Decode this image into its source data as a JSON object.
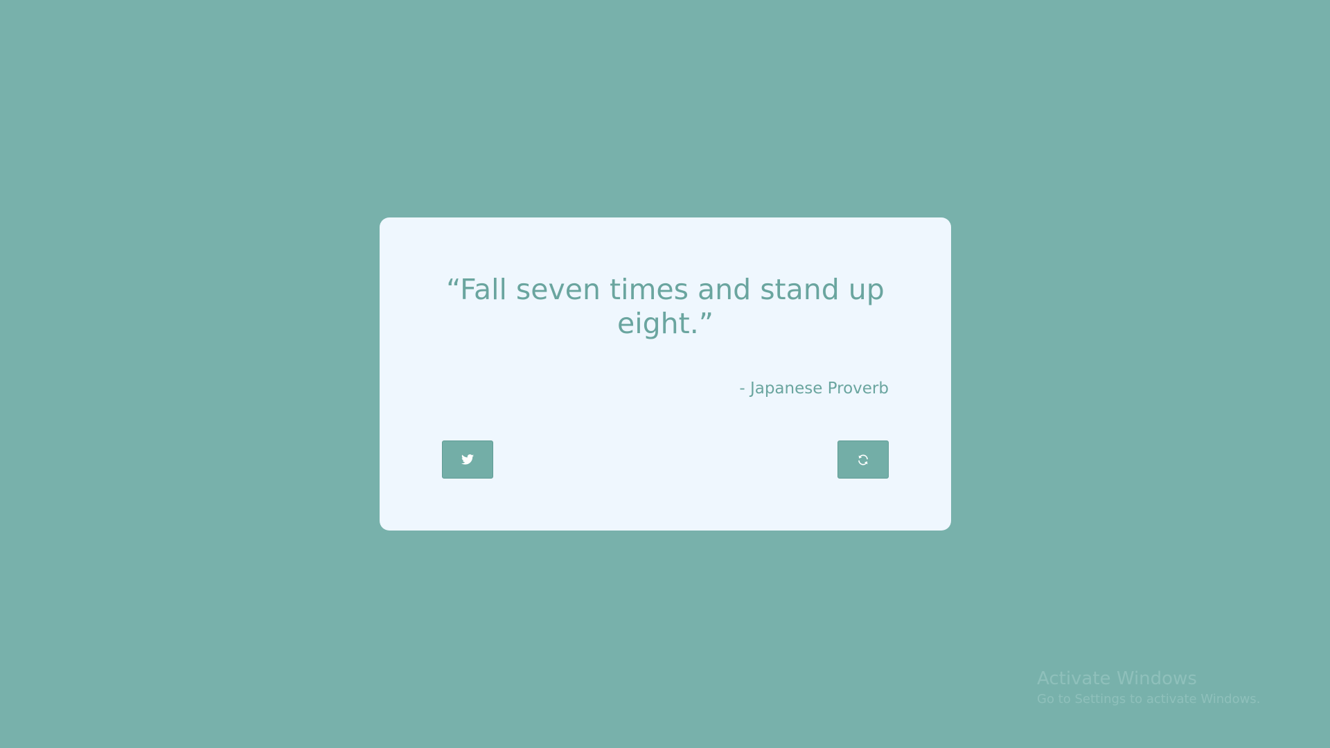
{
  "quote": {
    "text": "“Fall seven times and stand up eight.”",
    "author": "- Japanese Proverb"
  },
  "buttons": {
    "tweet_icon": "twitter-icon",
    "new_quote_icon": "refresh-icon"
  },
  "watermark": {
    "title": "Activate Windows",
    "subtitle": "Go to Settings to activate Windows."
  },
  "colors": {
    "background": "#78b1ab",
    "card": "#eff7fe",
    "accent": "#6aa59f",
    "button": "#73aea7"
  }
}
